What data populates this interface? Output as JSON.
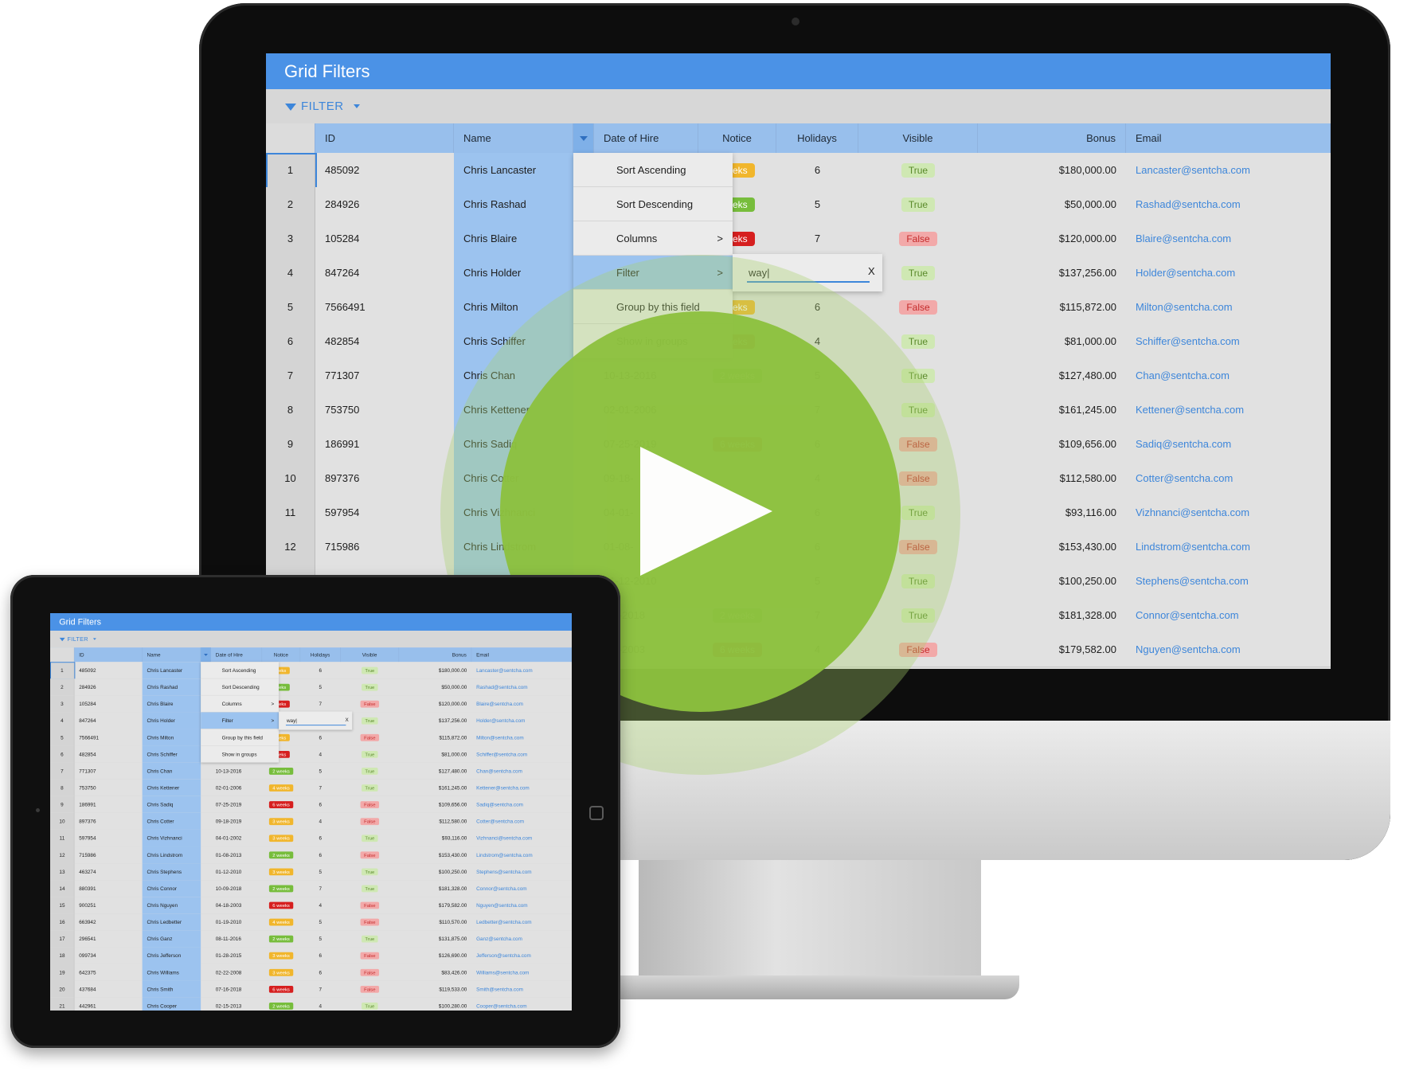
{
  "grid": {
    "title": "Grid Filters",
    "filter_label": "FILTER",
    "columns": [
      "ID",
      "Name",
      "Date of Hire",
      "Notice",
      "Holidays",
      "Visible",
      "Bonus",
      "Email"
    ],
    "rows": [
      {
        "n": "1",
        "id": "485092",
        "name": "Chris Lancaster",
        "date": "",
        "notice": "eeks",
        "notice_color": "#f1b62c",
        "holidays": "6",
        "visible": "True",
        "bonus": "$180,000.00",
        "email": "Lancaster@sentcha.com"
      },
      {
        "n": "2",
        "id": "284926",
        "name": "Chris Rashad",
        "date": "",
        "notice": "eeks",
        "notice_color": "#77bd3c",
        "holidays": "5",
        "visible": "True",
        "bonus": "$50,000.00",
        "email": "Rashad@sentcha.com"
      },
      {
        "n": "3",
        "id": "105284",
        "name": "Chris Blaire",
        "date": "",
        "notice": "eeks",
        "notice_color": "#d61f1f",
        "holidays": "7",
        "visible": "False",
        "bonus": "$120,000.00",
        "email": "Blaire@sentcha.com"
      },
      {
        "n": "4",
        "id": "847264",
        "name": "Chris Holder",
        "date": "",
        "notice": "",
        "notice_color": "",
        "holidays": "",
        "visible": "True",
        "bonus": "$137,256.00",
        "email": "Holder@sentcha.com"
      },
      {
        "n": "5",
        "id": "7566491",
        "name": "Chris Milton",
        "date": "",
        "notice": "eeks",
        "notice_color": "#f1b62c",
        "holidays": "6",
        "visible": "False",
        "bonus": "$115,872.00",
        "email": "Milton@sentcha.com"
      },
      {
        "n": "6",
        "id": "482854",
        "name": "Chris Schiffer",
        "date": "",
        "notice": "eeks",
        "notice_color": "#d61f1f",
        "holidays": "4",
        "visible": "True",
        "bonus": "$81,000.00",
        "email": "Schiffer@sentcha.com"
      },
      {
        "n": "7",
        "id": "771307",
        "name": "Chris Chan",
        "date": "10-13-2016",
        "notice": "2 weeks",
        "notice_color": "#77bd3c",
        "holidays": "5",
        "visible": "True",
        "bonus": "$127,480.00",
        "email": "Chan@sentcha.com"
      },
      {
        "n": "8",
        "id": "753750",
        "name": "Chris Kettener",
        "date": "02-01-2006",
        "notice": "",
        "notice_color": "#f1b62c",
        "holidays": "7",
        "visible": "True",
        "bonus": "$161,245.00",
        "email": "Kettener@sentcha.com"
      },
      {
        "n": "9",
        "id": "186991",
        "name": "Chris Sadiq",
        "date": "07-25-2019",
        "notice": "6 weeks",
        "notice_color": "#d61f1f",
        "holidays": "6",
        "visible": "False",
        "bonus": "$109,656.00",
        "email": "Sadiq@sentcha.com"
      },
      {
        "n": "10",
        "id": "897376",
        "name": "Chris Cotter",
        "date": "09-18-",
        "notice": "",
        "notice_color": "#f1b62c",
        "holidays": "4",
        "visible": "False",
        "bonus": "$112,580.00",
        "email": "Cotter@sentcha.com"
      },
      {
        "n": "11",
        "id": "597954",
        "name": "Chris Vizhnanci",
        "date": "04-01-",
        "notice": "",
        "notice_color": "#f1b62c",
        "holidays": "6",
        "visible": "True",
        "bonus": "$93,116.00",
        "email": "Vizhnanci@sentcha.com"
      },
      {
        "n": "12",
        "id": "715986",
        "name": "Chris Lindstrom",
        "date": "01-08-",
        "notice": "",
        "notice_color": "#77bd3c",
        "holidays": "6",
        "visible": "False",
        "bonus": "$153,430.00",
        "email": "Lindstrom@sentcha.com"
      },
      {
        "n": "",
        "id": "",
        "name": "",
        "date": "01-12-2010",
        "notice": "",
        "notice_color": "",
        "holidays": "5",
        "visible": "True",
        "bonus": "$100,250.00",
        "email": "Stephens@sentcha.com"
      },
      {
        "n": "",
        "id": "",
        "name": "",
        "date": "-09-2018",
        "notice": "2 weeks",
        "notice_color": "#77bd3c",
        "holidays": "7",
        "visible": "True",
        "bonus": "$181,328.00",
        "email": "Connor@sentcha.com"
      },
      {
        "n": "",
        "id": "",
        "name": "",
        "date": "-18-2003",
        "notice": "6 weeks",
        "notice_color": "#d61f1f",
        "holidays": "4",
        "visible": "False",
        "bonus": "$179,582.00",
        "email": "Nguyen@sentcha.com"
      }
    ],
    "menu": {
      "items": [
        "Sort Ascending",
        "Sort Descending",
        "Columns",
        "Filter",
        "Group by this field",
        "Show in groups"
      ],
      "arrow": ">",
      "filter_value": "way|",
      "clear_label": "X"
    }
  },
  "tablet_grid": {
    "title": "Grid Filters",
    "filter_label": "FILTER",
    "columns": [
      "ID",
      "Name",
      "Date of Hire",
      "Notice",
      "Holidays",
      "Visible",
      "Bonus",
      "Email"
    ],
    "rows": [
      {
        "n": "1",
        "id": "485092",
        "name": "Chris Lancaster",
        "date": "",
        "notice": "eeks",
        "notice_color": "#f1b62c",
        "holidays": "6",
        "visible": "True",
        "bonus": "$180,000.00",
        "email": "Lancaster@sentcha.com"
      },
      {
        "n": "2",
        "id": "284926",
        "name": "Chris Rashad",
        "date": "",
        "notice": "eeks",
        "notice_color": "#77bd3c",
        "holidays": "5",
        "visible": "True",
        "bonus": "$50,000.00",
        "email": "Rashad@sentcha.com"
      },
      {
        "n": "3",
        "id": "105284",
        "name": "Chris Blaire",
        "date": "",
        "notice": "eeks",
        "notice_color": "#d61f1f",
        "holidays": "7",
        "visible": "False",
        "bonus": "$120,000.00",
        "email": "Blaire@sentcha.com"
      },
      {
        "n": "4",
        "id": "847264",
        "name": "Chris Holder",
        "date": "",
        "notice": "",
        "notice_color": "",
        "holidays": "",
        "visible": "True",
        "bonus": "$137,256.00",
        "email": "Holder@sentcha.com"
      },
      {
        "n": "5",
        "id": "7566491",
        "name": "Chris Milton",
        "date": "",
        "notice": "eeks",
        "notice_color": "#f1b62c",
        "holidays": "6",
        "visible": "False",
        "bonus": "$115,872.00",
        "email": "Milton@sentcha.com"
      },
      {
        "n": "6",
        "id": "482854",
        "name": "Chris Schiffer",
        "date": "",
        "notice": "eeks",
        "notice_color": "#d61f1f",
        "holidays": "4",
        "visible": "True",
        "bonus": "$81,000.00",
        "email": "Schiffer@sentcha.com"
      },
      {
        "n": "7",
        "id": "771307",
        "name": "Chris Chan",
        "date": "10-13-2016",
        "notice": "2 weeks",
        "notice_color": "#77bd3c",
        "holidays": "5",
        "visible": "True",
        "bonus": "$127,480.00",
        "email": "Chan@sentcha.com"
      },
      {
        "n": "8",
        "id": "753750",
        "name": "Chris Kettener",
        "date": "02-01-2006",
        "notice": "4 weeks",
        "notice_color": "#f1b62c",
        "holidays": "7",
        "visible": "True",
        "bonus": "$161,245.00",
        "email": "Kettener@sentcha.com"
      },
      {
        "n": "9",
        "id": "186991",
        "name": "Chris Sadiq",
        "date": "07-25-2019",
        "notice": "6 weeks",
        "notice_color": "#d61f1f",
        "holidays": "6",
        "visible": "False",
        "bonus": "$109,656.00",
        "email": "Sadiq@sentcha.com"
      },
      {
        "n": "10",
        "id": "897376",
        "name": "Chris Cotter",
        "date": "09-18-2019",
        "notice": "3 weeks",
        "notice_color": "#f1b62c",
        "holidays": "4",
        "visible": "False",
        "bonus": "$112,580.00",
        "email": "Cotter@sentcha.com"
      },
      {
        "n": "11",
        "id": "597954",
        "name": "Chris Vizhnanci",
        "date": "04-01-2002",
        "notice": "3 weeks",
        "notice_color": "#f1b62c",
        "holidays": "6",
        "visible": "True",
        "bonus": "$93,116.00",
        "email": "Vizhnanci@sentcha.com"
      },
      {
        "n": "12",
        "id": "715986",
        "name": "Chris Lindstrom",
        "date": "01-08-2013",
        "notice": "2 weeks",
        "notice_color": "#77bd3c",
        "holidays": "6",
        "visible": "False",
        "bonus": "$153,430.00",
        "email": "Lindstrom@sentcha.com"
      },
      {
        "n": "13",
        "id": "463274",
        "name": "Chris Stephens",
        "date": "01-12-2010",
        "notice": "3 weeks",
        "notice_color": "#f1b62c",
        "holidays": "5",
        "visible": "True",
        "bonus": "$100,250.00",
        "email": "Stephens@sentcha.com"
      },
      {
        "n": "14",
        "id": "880391",
        "name": "Chris Connor",
        "date": "10-09-2018",
        "notice": "2 weeks",
        "notice_color": "#77bd3c",
        "holidays": "7",
        "visible": "True",
        "bonus": "$181,328.00",
        "email": "Connor@sentcha.com"
      },
      {
        "n": "15",
        "id": "900251",
        "name": "Chris Nguyen",
        "date": "04-18-2003",
        "notice": "6 weeks",
        "notice_color": "#d61f1f",
        "holidays": "4",
        "visible": "False",
        "bonus": "$179,582.00",
        "email": "Nguyen@sentcha.com"
      },
      {
        "n": "16",
        "id": "663942",
        "name": "Chris Ledbetter",
        "date": "01-19-2010",
        "notice": "4 weeks",
        "notice_color": "#f1b62c",
        "holidays": "5",
        "visible": "False",
        "bonus": "$110,570.00",
        "email": "Ledbetter@sentcha.com"
      },
      {
        "n": "17",
        "id": "296541",
        "name": "Chris Ganz",
        "date": "08-11-2016",
        "notice": "2 weeks",
        "notice_color": "#77bd3c",
        "holidays": "5",
        "visible": "True",
        "bonus": "$131,875.00",
        "email": "Ganz@sentcha.com"
      },
      {
        "n": "18",
        "id": "099734",
        "name": "Chris Jefferson",
        "date": "01-28-2015",
        "notice": "3 weeks",
        "notice_color": "#f1b62c",
        "holidays": "6",
        "visible": "False",
        "bonus": "$126,690.00",
        "email": "Jefferson@sentcha.com"
      },
      {
        "n": "19",
        "id": "642375",
        "name": "Chris Williams",
        "date": "02-22-2008",
        "notice": "3 weeks",
        "notice_color": "#f1b62c",
        "holidays": "6",
        "visible": "False",
        "bonus": "$83,426.00",
        "email": "Williams@sentcha.com"
      },
      {
        "n": "20",
        "id": "437684",
        "name": "Chris Smith",
        "date": "07-16-2018",
        "notice": "6 weeks",
        "notice_color": "#d61f1f",
        "holidays": "7",
        "visible": "False",
        "bonus": "$119,533.00",
        "email": "Smith@sentcha.com"
      },
      {
        "n": "21",
        "id": "442961",
        "name": "Chris Cooper",
        "date": "02-15-2013",
        "notice": "2 weeks",
        "notice_color": "#77bd3c",
        "holidays": "4",
        "visible": "True",
        "bonus": "$100,280.00",
        "email": "Cooper@sentcha.com"
      }
    ],
    "menu": {
      "items": [
        "Sort Ascending",
        "Sort Descending",
        "Columns",
        "Filter",
        "Group by this field",
        "Show in groups"
      ],
      "arrow": ">",
      "filter_value": "way|",
      "clear_label": "X"
    }
  },
  "colors": {
    "accent": "#4b92e6",
    "header": "#98bfec",
    "play_green": "#8dc13e",
    "notice_yellow": "#f1b62c",
    "notice_green": "#77bd3c",
    "notice_red": "#d61f1f"
  },
  "icons": {
    "play": "play-icon",
    "filter": "funnel-icon",
    "dropdown": "caret-down-icon"
  }
}
